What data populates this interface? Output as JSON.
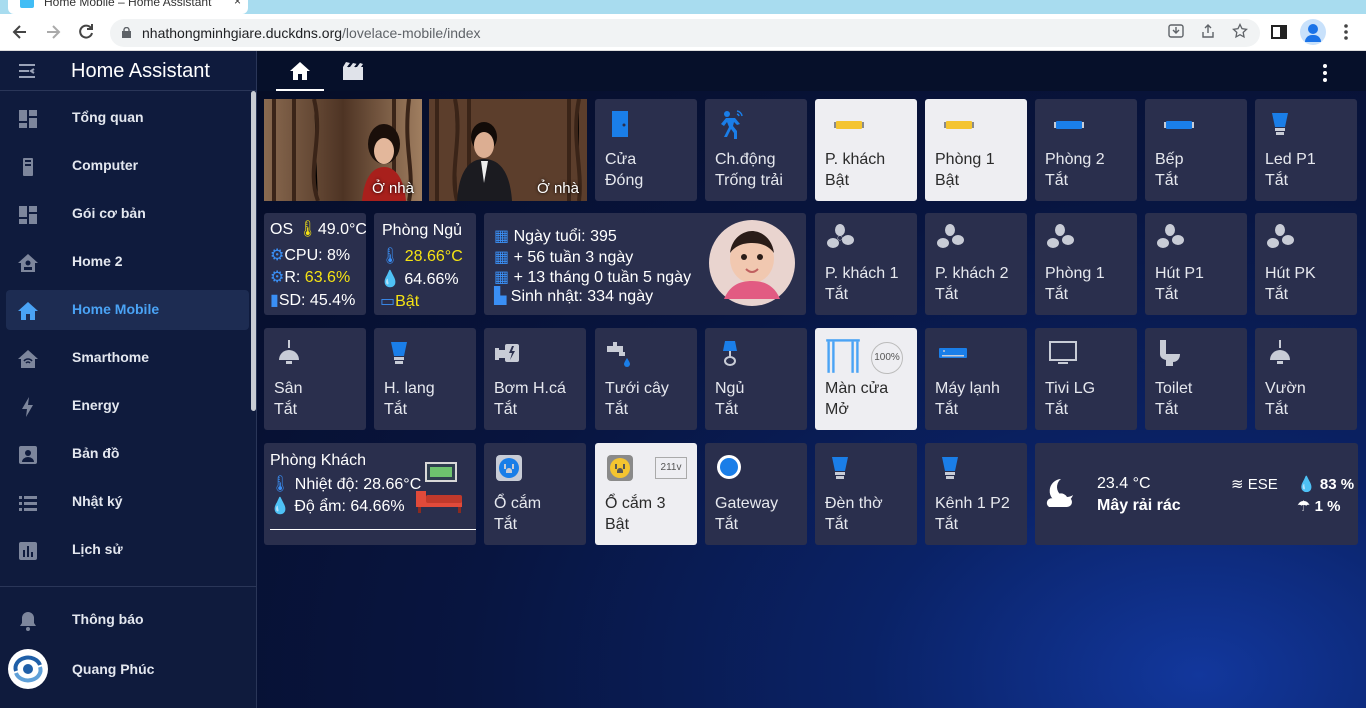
{
  "browser": {
    "tab_title": "Home Mobile – Home Assistant",
    "tab_close": "×",
    "url_host": "nhathongminhgiare.duckdns.org",
    "url_path": "/lovelace-mobile/index"
  },
  "sidebar": {
    "title": "Home Assistant",
    "items": [
      {
        "label": "Tổng quan",
        "icon": "dashboard-icon"
      },
      {
        "label": "Computer",
        "icon": "computer-icon"
      },
      {
        "label": "Gói cơ bản",
        "icon": "dashboard-icon"
      },
      {
        "label": "Home 2",
        "icon": "home-account-icon"
      },
      {
        "label": "Home Mobile",
        "icon": "home-icon",
        "active": true
      },
      {
        "label": "Smarthome",
        "icon": "home-automation-icon"
      },
      {
        "label": "Energy",
        "icon": "lightning-bolt-icon"
      },
      {
        "label": "Bản đồ",
        "icon": "account-box-icon"
      },
      {
        "label": "Nhật ký",
        "icon": "list-icon"
      },
      {
        "label": "Lịch sử",
        "icon": "chart-box-icon"
      }
    ],
    "notifications": "Thông báo",
    "user": "Quang Phúc"
  },
  "photos": [
    {
      "label": "Ở nhà"
    },
    {
      "label": "Ở nhà"
    }
  ],
  "tiles": {
    "cua": {
      "name": "Cửa",
      "state": "Đóng"
    },
    "chdong": {
      "name": "Ch.động",
      "state": "Trống trải"
    },
    "pkhach": {
      "name": "P. khách",
      "state": "Bật"
    },
    "phong1": {
      "name": "Phòng 1",
      "state": "Bật"
    },
    "phong2": {
      "name": "Phòng 2",
      "state": "Tắt"
    },
    "bep": {
      "name": "Bếp",
      "state": "Tắt"
    },
    "ledp1": {
      "name": "Led P1",
      "state": "Tắt"
    },
    "fan_pk1": {
      "name": "P. khách 1",
      "state": "Tắt"
    },
    "fan_pk2": {
      "name": "P. khách 2",
      "state": "Tắt"
    },
    "fan_p1": {
      "name": "Phòng 1",
      "state": "Tắt"
    },
    "fan_hutp1": {
      "name": "Hút P1",
      "state": "Tắt"
    },
    "fan_hutpk": {
      "name": "Hút PK",
      "state": "Tắt"
    },
    "san": {
      "name": "Sân",
      "state": "Tắt"
    },
    "hlang": {
      "name": "H. lang",
      "state": "Tắt"
    },
    "bomhca": {
      "name": "Bơm H.cá",
      "state": "Tắt"
    },
    "tuoicay": {
      "name": "Tưới cây",
      "state": "Tắt"
    },
    "ngu": {
      "name": "Ngủ",
      "state": "Tắt"
    },
    "mancua": {
      "name": "Màn cửa",
      "state": "Mở",
      "badge": "100%"
    },
    "maylanh": {
      "name": "Máy lạnh",
      "state": "Tắt"
    },
    "tivi": {
      "name": "Tivi LG",
      "state": "Tắt"
    },
    "toilet": {
      "name": "Toilet",
      "state": "Tắt"
    },
    "vuon": {
      "name": "Vườn",
      "state": "Tắt"
    },
    "ocam": {
      "name": "Ổ cắm",
      "state": "Tắt"
    },
    "ocam3": {
      "name": "Ổ cắm 3",
      "state": "Bật",
      "badge": "211v"
    },
    "gateway": {
      "name": "Gateway",
      "state": "Tắt"
    },
    "dentho": {
      "name": "Đèn thờ",
      "state": "Tắt"
    },
    "kenh1p2": {
      "name": "Kênh 1 P2",
      "state": "Tắt"
    }
  },
  "os_card": {
    "os_label": "OS",
    "os_temp": "49.0°C",
    "cpu": "CPU: 8%",
    "ram_label": "R:",
    "ram_value": "63.6%",
    "sd": "SD: 45.4%"
  },
  "room_card": {
    "title": "Phòng Ngủ",
    "temp": "28.66°C",
    "humidity": "64.66%",
    "ac_state": "Bật"
  },
  "baby_card": {
    "lines": [
      "Ngày tuổi: 395",
      "+ 56 tuần 3 ngày",
      "+ 13 tháng 0 tuần 5 ngày",
      "Sinh nhật: 334 ngày"
    ]
  },
  "living_card": {
    "title": "Phòng Khách",
    "temp": "Nhiệt độ: 28.66°C",
    "humidity": "Độ ẩm: 64.66%"
  },
  "weather": {
    "temp": "23.4 °C",
    "condition": "Mây rải rác",
    "wind": "ESE",
    "humidity": "83 %",
    "rain": "1 %"
  },
  "colors": {
    "accent": "#4aa3f5",
    "on_tile": "#eeeef2",
    "off_tile": "#2a2f4d",
    "yellow": "#f5e313"
  }
}
